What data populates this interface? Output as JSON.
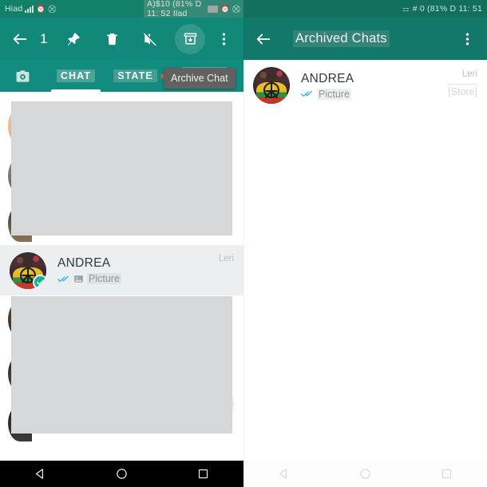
{
  "left": {
    "statusbar": {
      "carrier": "Hiad",
      "icons": [
        "signal-bars-icon",
        "alarm-icon",
        "dnd-icon"
      ],
      "overlay_text": "A)$10 (81% D 11: 52 Ilad"
    },
    "appbar": {
      "back_icon": "back-arrow-icon",
      "selected_count": "1",
      "actions": [
        {
          "name": "pin-icon",
          "label": "Pin"
        },
        {
          "name": "delete-icon",
          "label": "Delete"
        },
        {
          "name": "mute-icon",
          "label": "Mute"
        },
        {
          "name": "archive-icon",
          "label": "Archive",
          "highlighted": true
        },
        {
          "name": "overflow-menu-icon",
          "label": "More options"
        }
      ]
    },
    "tabs": [
      {
        "name": "tab-camera",
        "label": "",
        "icon": "camera-icon",
        "active": false
      },
      {
        "name": "tab-chats",
        "label": "CHAT",
        "active": true
      },
      {
        "name": "tab-status",
        "label": "STATE",
        "active": false,
        "dot": true
      },
      {
        "name": "tab-calls",
        "label": "",
        "active": false,
        "obscured": true
      }
    ],
    "tooltip": "Archive Chat",
    "selected_row": {
      "name": "ANDREA",
      "tick": "double-check-icon",
      "attachment_icon": "image-icon",
      "message": "Picture",
      "time": "Leri",
      "selected": true
    },
    "fab": "new-chat-fab"
  },
  "right": {
    "statusbar": {
      "overlay_text": "# 0 (81% D 11: 51",
      "icons": [
        "sim-icon"
      ]
    },
    "appbar": {
      "back_icon": "back-arrow-icon",
      "title": "Archived Chats",
      "overflow_icon": "overflow-menu-icon"
    },
    "row": {
      "name": "ANDREA",
      "tick": "double-check-icon",
      "message": "Picture",
      "time": "Leri",
      "badge": "[Store]"
    }
  },
  "navbar": {
    "back": "nav-back-icon",
    "home": "nav-home-icon",
    "recents": "nav-recents-icon"
  },
  "colors": {
    "teal": "#128c7e",
    "teal_dark": "#138068",
    "accent_green": "#2bb33f",
    "check_teal": "#13b29a",
    "tick_blue": "#34b7f1",
    "redaction": "#d6d7d8",
    "selected_row": "#eceff1"
  }
}
